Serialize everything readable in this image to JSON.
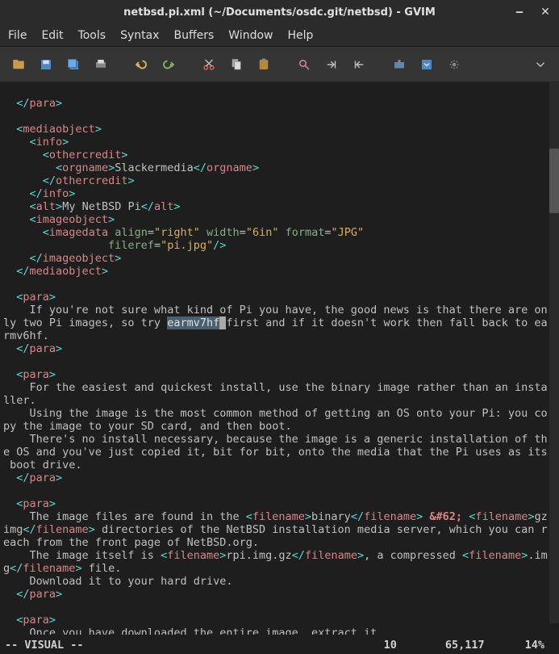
{
  "window": {
    "title": "netbsd.pi.xml (~/Documents/osdc.git/netbsd) - GVIM"
  },
  "menu": {
    "items": [
      "File",
      "Edit",
      "Tools",
      "Syntax",
      "Buffers",
      "Window",
      "Help"
    ]
  },
  "status": {
    "mode": "-- VISUAL --",
    "count": "10",
    "pos": "65,117",
    "pct": "14%"
  },
  "code": {
    "l01p1": "</",
    "l01t": "para",
    "l01p2": ">",
    "l02p1": "<",
    "l02t": "mediaobject",
    "l02p2": ">",
    "l03p1": "<",
    "l03t": "info",
    "l03p2": ">",
    "l04p1": "<",
    "l04t": "othercredit",
    "l04p2": ">",
    "l05p1": "<",
    "l05ta": "orgname",
    "l05p2": ">",
    "l05tx": "Slackermedia",
    "l05p3": "</",
    "l05tb": "orgname",
    "l05p4": ">",
    "l06p1": "</",
    "l06t": "othercredit",
    "l06p2": ">",
    "l07p1": "</",
    "l07t": "info",
    "l07p2": ">",
    "l08p1": "<",
    "l08ta": "alt",
    "l08p2": ">",
    "l08tx": "My NetBSD Pi",
    "l08p3": "</",
    "l08tb": "alt",
    "l08p4": ">",
    "l09p1": "<",
    "l09t": "imageobject",
    "l09p2": ">",
    "l10p1": "<",
    "l10t": "imagedata",
    "l10sp": " ",
    "l10a1": "align",
    "l10e1": "=",
    "l10v1": "\"right\"",
    "l10sp2": " ",
    "l10a2": "width",
    "l10e2": "=",
    "l10v2": "\"6in\"",
    "l10sp3": " ",
    "l10a3": "format",
    "l10e3": "=",
    "l10v3": "\"JPG\"",
    "l11a1": "fileref",
    "l11e1": "=",
    "l11v1": "\"pi.jpg\"",
    "l11p2": "/>",
    "l12p1": "</",
    "l12t": "imageobject",
    "l12p2": ">",
    "l13p1": "</",
    "l13t": "mediaobject",
    "l13p2": ">",
    "l14p1": "<",
    "l14t": "para",
    "l14p2": ">",
    "l15tx1": "    If you're not sure what kind of Pi you have, the good news is that there are on",
    "l16tx1": "ly two Pi images, so try ",
    "l16sel": "earmv7hf",
    "l16cur": " ",
    "l16tx2": "first and if it doesn't work then fall back to ea",
    "l17tx": "rmv6hf.",
    "l18p1": "</",
    "l18t": "para",
    "l18p2": ">",
    "l19p1": "<",
    "l19t": "para",
    "l19p2": ">",
    "l20tx": "    For the easiest and quickest install, use the binary image rather than an insta",
    "l21tx": "ller.",
    "l22tx": "    Using the image is the most common method of getting an OS onto your Pi: you co",
    "l23tx": "py the image to your SD card, and then boot.",
    "l24tx": "    There's no install necessary, because the image is a generic installation of th",
    "l25tx": "e OS and you've just copied it, bit for bit, onto the media that the Pi uses as its",
    "l26tx": " boot drive.",
    "l27p1": "</",
    "l27t": "para",
    "l27p2": ">",
    "l28p1": "<",
    "l28t": "para",
    "l28p2": ">",
    "l29tx1": "    The image files are found in the ",
    "l29p1": "<",
    "l29ta": "filename",
    "l29p2": ">",
    "l29tx2": "binary",
    "l29p3": "</",
    "l29tb": "filename",
    "l29p4": ">",
    "l29sp": " ",
    "l29ent": "&#62;",
    "l29tx3": " ",
    "l29p5": "<",
    "l29tc": "filename",
    "l29p6": ">",
    "l29tx4": "gz",
    "l30tx1": "img",
    "l30p1": "</",
    "l30t": "filename",
    "l30p2": ">",
    "l30tx2": " directories of the NetBSD installation media server, which you can r",
    "l31tx": "each from the front page of NetBSD.org.",
    "l32tx1": "    The image itself is ",
    "l32p1": "<",
    "l32ta": "filename",
    "l32p2": ">",
    "l32tx2": "rpi.img.gz",
    "l32p3": "</",
    "l32tb": "filename",
    "l32p4": ">",
    "l32tx3": ", a compressed ",
    "l32p5": "<",
    "l32tc": "filename",
    "l32p6": ">",
    "l32tx4": ".im",
    "l33tx1": "g",
    "l33p1": "</",
    "l33t": "filename",
    "l33p2": ">",
    "l33tx2": " file.",
    "l34tx": "    Download it to your hard drive.",
    "l35p1": "</",
    "l35t": "para",
    "l35p2": ">",
    "l36p1": "<",
    "l36t": "para",
    "l36p2": ">",
    "l37tx": "    Once you have downloaded the entire image, extract it."
  }
}
